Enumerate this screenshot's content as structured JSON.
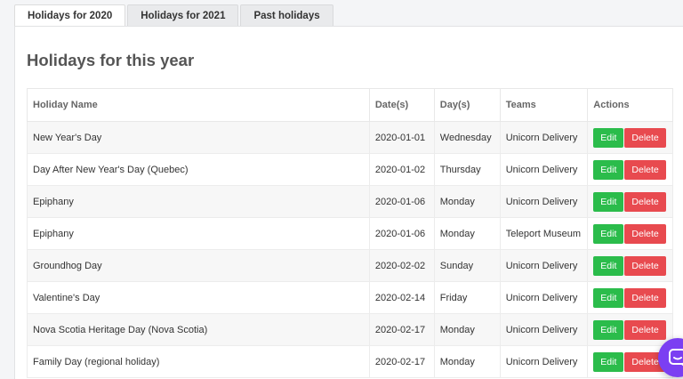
{
  "tabs": [
    {
      "label": "Holidays for 2020",
      "active": true
    },
    {
      "label": "Holidays for 2021",
      "active": false
    },
    {
      "label": "Past holidays",
      "active": false
    }
  ],
  "panel": {
    "title": "Holidays for this year"
  },
  "table": {
    "headers": [
      "Holiday Name",
      "Date(s)",
      "Day(s)",
      "Teams",
      "Actions"
    ],
    "rows": [
      {
        "name": "New Year's Day",
        "date": "2020-01-01",
        "day": "Wednesday",
        "team": "Unicorn Delivery"
      },
      {
        "name": "Day After New Year's Day (Quebec)",
        "date": "2020-01-02",
        "day": "Thursday",
        "team": "Unicorn Delivery"
      },
      {
        "name": "Epiphany",
        "date": "2020-01-06",
        "day": "Monday",
        "team": "Unicorn Delivery"
      },
      {
        "name": "Epiphany",
        "date": "2020-01-06",
        "day": "Monday",
        "team": "Teleport Museum"
      },
      {
        "name": "Groundhog Day",
        "date": "2020-02-02",
        "day": "Sunday",
        "team": "Unicorn Delivery"
      },
      {
        "name": "Valentine's Day",
        "date": "2020-02-14",
        "day": "Friday",
        "team": "Unicorn Delivery"
      },
      {
        "name": "Nova Scotia Heritage Day (Nova Scotia)",
        "date": "2020-02-17",
        "day": "Monday",
        "team": "Unicorn Delivery"
      },
      {
        "name": "Family Day (regional holiday)",
        "date": "2020-02-17",
        "day": "Monday",
        "team": "Unicorn Delivery"
      }
    ]
  },
  "actions": {
    "edit_label": "Edit",
    "delete_label": "Delete"
  },
  "colors": {
    "edit": "#2bbc4b",
    "delete": "#e84a4f",
    "chat": "#7b3ff2"
  },
  "chat": {
    "icon": "chat-icon"
  }
}
